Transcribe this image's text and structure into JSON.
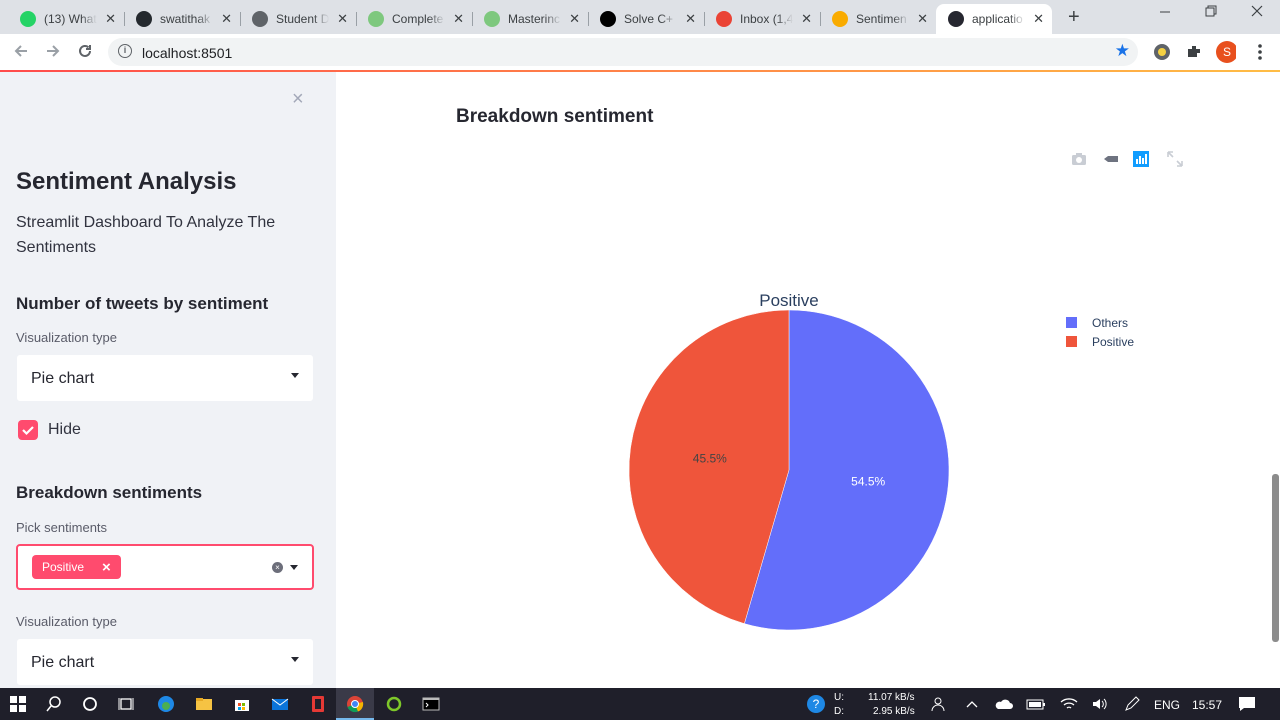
{
  "browser": {
    "tabs": [
      {
        "title": "(13) What",
        "icon": "whatsapp-icon",
        "color": "#25d366",
        "active": false
      },
      {
        "title": "swatithak",
        "icon": "github-icon",
        "color": "#24292e",
        "active": false
      },
      {
        "title": "Student D",
        "icon": "globe-icon",
        "color": "#5f6368",
        "active": false
      },
      {
        "title": "Complete",
        "icon": "video-icon",
        "color": "#7ec87e",
        "active": false
      },
      {
        "title": "Masterinc",
        "icon": "video-icon",
        "color": "#7ec87e",
        "active": false
      },
      {
        "title": "Solve C+",
        "icon": "hackerrank-icon",
        "color": "#000000",
        "active": false
      },
      {
        "title": "Inbox (1,4",
        "icon": "gmail-icon",
        "color": "#ea4335",
        "active": false
      },
      {
        "title": "Sentimen",
        "icon": "colab-icon",
        "color": "#f9ab00",
        "active": false
      },
      {
        "title": "applicatio",
        "icon": "streamlit-icon",
        "color": "#262730",
        "active": true
      }
    ],
    "new_tab_symbol": "+",
    "url": "localhost:8501",
    "profile_initial": "S",
    "profile_color": "#e8501e"
  },
  "sidebar": {
    "close_symbol": "×",
    "title": "Sentiment Analysis",
    "subtitle": "Streamlit Dashboard To Analyze The Sentiments",
    "section1": {
      "heading": "Number of tweets by sentiment",
      "label": "Visualization type",
      "selected": "Pie chart",
      "checkbox_label": "Hide",
      "checkbox_checked": true
    },
    "section2": {
      "heading": "Breakdown sentiments",
      "pick_label": "Pick sentiments",
      "chips": [
        "Positive"
      ],
      "viz_label": "Visualization type",
      "viz_selected": "Pie chart"
    }
  },
  "main": {
    "title": "Breakdown sentiment",
    "modebar": [
      "camera-icon",
      "pan-icon",
      "bar-chart-icon",
      "autoscale-icon"
    ]
  },
  "chart_data": {
    "type": "pie",
    "title": "Positive",
    "categories": [
      "Others",
      "Positive"
    ],
    "values": [
      54.5,
      45.5
    ],
    "colors": [
      "#636efa",
      "#ef553b"
    ],
    "labels_text": [
      "54.5%",
      "45.5%"
    ],
    "legend": "top-right"
  },
  "taskbar": {
    "upload_label": "U:",
    "download_label": "D:",
    "upload_speed": "11.07 kB/s",
    "download_speed": "2.95 kB/s",
    "lang": "ENG",
    "time": "15:57"
  }
}
